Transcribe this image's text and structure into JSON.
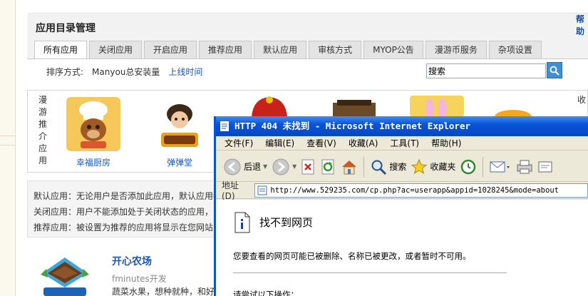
{
  "header": {
    "title": "应用目录管理",
    "help_link": "帮助"
  },
  "tabs": [
    {
      "label": "所有应用",
      "active": true
    },
    {
      "label": "关闭应用"
    },
    {
      "label": "开启应用"
    },
    {
      "label": "推荐应用"
    },
    {
      "label": "默认应用"
    },
    {
      "label": "审核方式"
    },
    {
      "label": "MYOP公告"
    },
    {
      "label": "漫游币服务"
    },
    {
      "label": "杂项设置"
    }
  ],
  "sort": {
    "label": "排序方式:",
    "option_current": "Manyou总安装量",
    "option_link": "上线时间"
  },
  "search": {
    "value": "搜索",
    "button_icon": "search-icon"
  },
  "app_list": {
    "vertical_label": "漫游推介应用",
    "side_label": "收",
    "apps": [
      {
        "name": "幸福厨房",
        "icon": "chef-dog-icon"
      },
      {
        "name": "弹弹堂",
        "icon": "ddtank-icon"
      }
    ]
  },
  "notes": [
    "默认应用：无论用户是否添加此应用，默认应用都",
    "关闭应用：用户不能添加处于关闭状态的应用，",
    "推荐应用：被设置为推荐的应用将显示在您网站"
  ],
  "featured": {
    "name": "开心农场",
    "developer": "fminutes开发",
    "description": "蔬菜水果，想种就种，和好"
  },
  "ie_window": {
    "title": "HTTP 404 未找到 - Microsoft Internet Explorer",
    "menu": [
      "文件(F)",
      "编辑(E)",
      "查看(V)",
      "收藏(A)",
      "工具(T)",
      "帮助(H)"
    ],
    "toolbar": {
      "back": "后退",
      "search": "搜索",
      "favorites": "收藏夹"
    },
    "address_label": "地址(D)",
    "address_url": "http://www.529235.com/cp.php?ac=userapp&appid=1028245&mode=about",
    "error_title": "找不到网页",
    "error_message": "您要查看的网页可能已被删除、名称已被更改，或者暂时不可用。",
    "error_more": "请尝试以下操作："
  }
}
